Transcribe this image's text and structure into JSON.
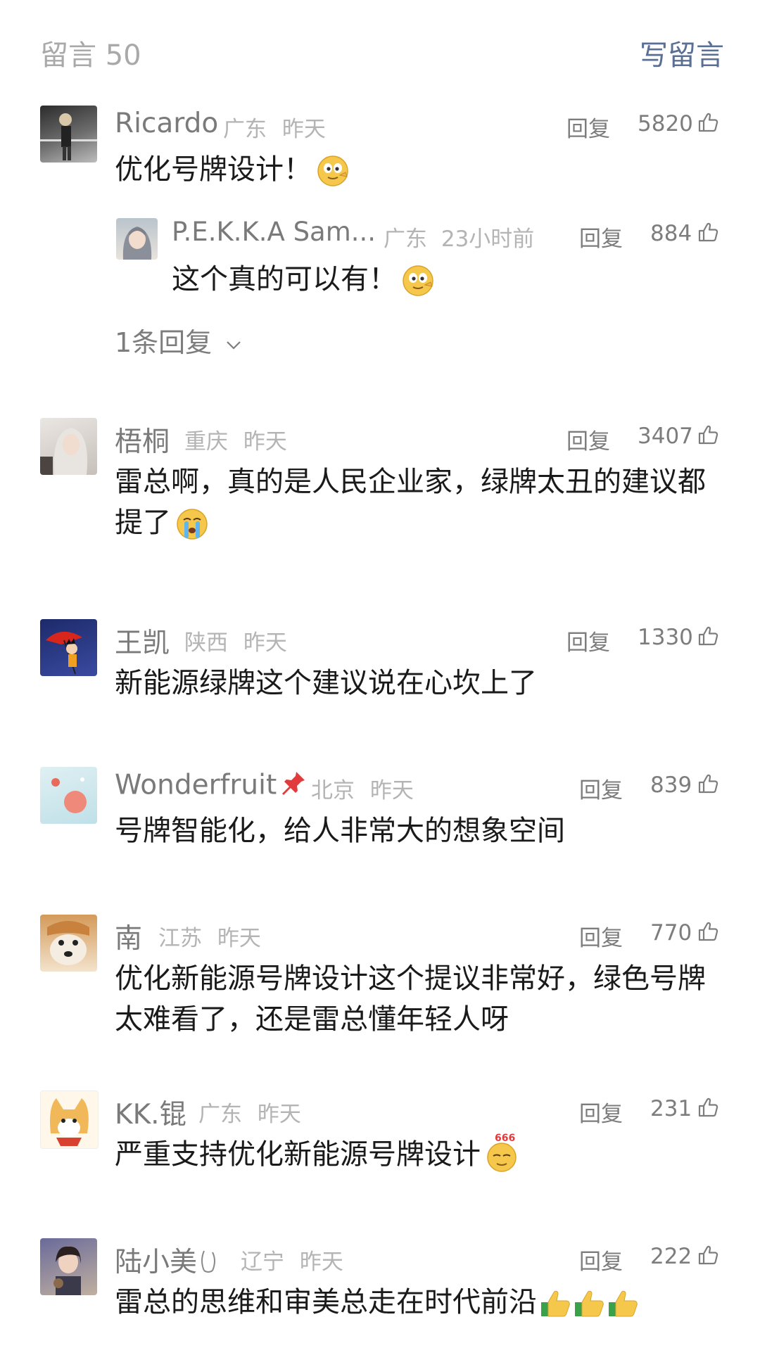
{
  "header": {
    "comment_count": "留言 50",
    "write_comment": "写留言"
  },
  "comments": [
    {
      "name": "Ricardo",
      "region": "广东",
      "time": "昨天",
      "reply_label": "回复",
      "likes": "5820",
      "text": "优化号牌设计！",
      "sub_reply": {
        "name": "P.E.K.K.A Sam...",
        "region": "广东",
        "time": "23小时前",
        "reply_label": "回复",
        "likes": "884",
        "text": "这个真的可以有！"
      },
      "more_replies": "1条回复"
    },
    {
      "name": "梧桐",
      "region": "重庆",
      "time": "昨天",
      "reply_label": "回复",
      "likes": "3407",
      "text_line1": "雷总啊，真的是人民企业家，绿牌太丑的建议都",
      "text_line2": "提了"
    },
    {
      "name": "王凯",
      "region": "陕西",
      "time": "昨天",
      "reply_label": "回复",
      "likes": "1330",
      "text": "新能源绿牌这个建议说在心坎上了"
    },
    {
      "name": "Wonderfruit",
      "region": "北京",
      "time": "昨天",
      "reply_label": "回复",
      "likes": "839",
      "text": "号牌智能化，给人非常大的想象空间"
    },
    {
      "name": "南",
      "region": "江苏",
      "time": "昨天",
      "reply_label": "回复",
      "likes": "770",
      "text_line1": "优化新能源号牌设计这个提议非常好，绿色号牌",
      "text_line2": "太难看了，还是雷总懂年轻人呀"
    },
    {
      "name": "KK.锟",
      "region": "广东",
      "time": "昨天",
      "reply_label": "回复",
      "likes": "231",
      "text": "严重支持优化新能源号牌设计",
      "emoji_text": "666"
    },
    {
      "name": "陆小美",
      "region": "辽宁",
      "time": "昨天",
      "reply_label": "回复",
      "likes": "222",
      "text": "雷总的思维和审美总走在时代前沿"
    }
  ],
  "icons": {
    "like": "thumbs-up-outline-icon",
    "chevron": "chevron-down-icon"
  },
  "colors": {
    "link": "#5a6f94",
    "meta": "#b4b4b4",
    "muted": "#7d7d7d"
  }
}
